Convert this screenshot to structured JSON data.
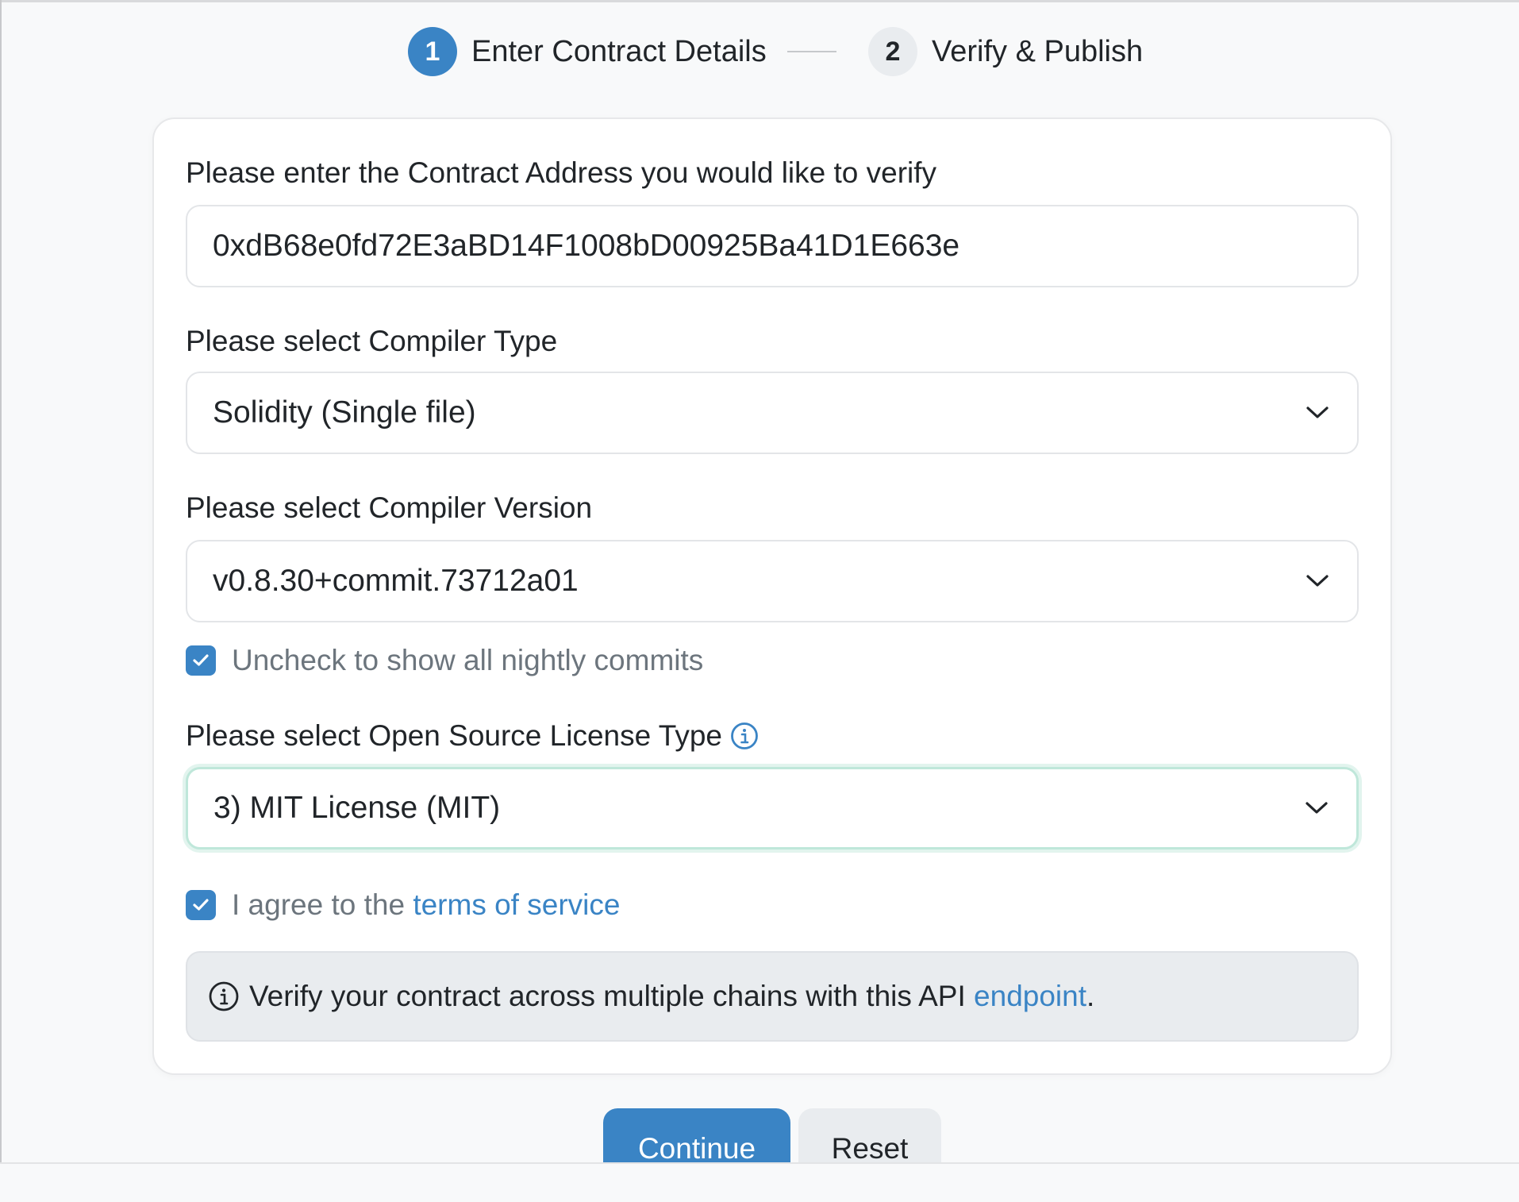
{
  "stepper": {
    "step1": {
      "number": "1",
      "label": "Enter Contract Details",
      "state": "active"
    },
    "step2": {
      "number": "2",
      "label": "Verify & Publish",
      "state": "inactive"
    }
  },
  "form": {
    "address_label": "Please enter the Contract Address you would like to verify",
    "address_value": "0xdB68e0fd72E3aBD14F1008bD00925Ba41D1E663e",
    "compiler_type_label": "Please select Compiler Type",
    "compiler_type_value": "Solidity (Single file)",
    "compiler_version_label": "Please select Compiler Version",
    "compiler_version_value": "v0.8.30+commit.73712a01",
    "nightly_checkbox_label": "Uncheck to show all nightly commits",
    "nightly_checked": true,
    "license_label": "Please select Open Source License Type",
    "license_value": "3) MIT License (MIT)",
    "terms_prefix": "I agree to the ",
    "terms_link": "terms of service",
    "terms_checked": true,
    "alert_text": "Verify your contract across multiple chains with this API ",
    "alert_link": "endpoint",
    "alert_suffix": "."
  },
  "buttons": {
    "continue_label": "Continue",
    "reset_label": "Reset"
  },
  "colors": {
    "primary": "#3a84c5",
    "focus_border": "#bfe7da"
  },
  "icons": {
    "chevron": "chevron-down-icon",
    "info": "info-circle-icon",
    "check": "checkmark-icon"
  }
}
